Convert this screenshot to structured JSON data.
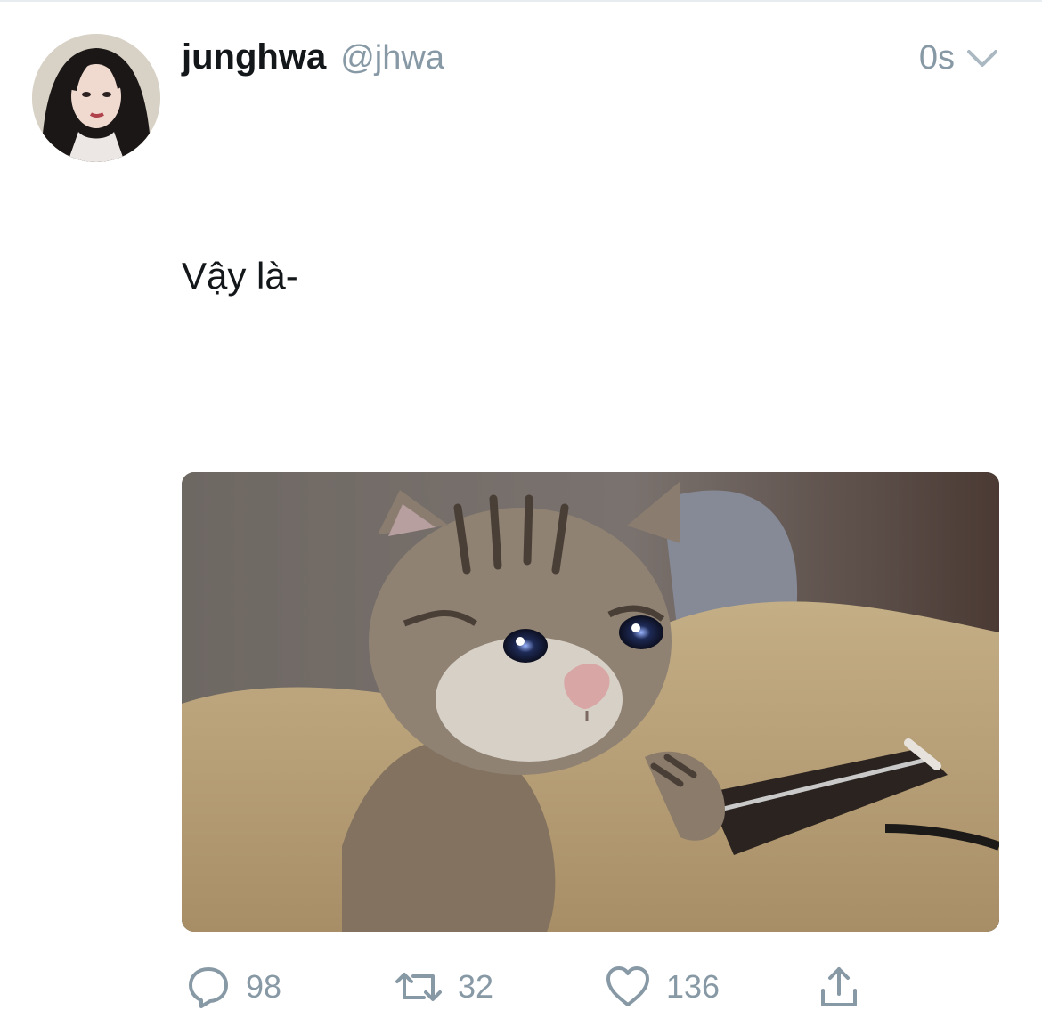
{
  "tweet": {
    "display_name": "junghwa",
    "handle": "@jhwa",
    "timestamp": "0s",
    "text": "Vậy là-",
    "avatar_icon": "profile-photo",
    "media_icon": "crying-cat-photo",
    "actions": {
      "reply_count": "98",
      "retweet_count": "32",
      "like_count": "136"
    }
  },
  "colors": {
    "text": "#14171a",
    "secondary": "#8899a6",
    "border": "#e6ecf0"
  }
}
